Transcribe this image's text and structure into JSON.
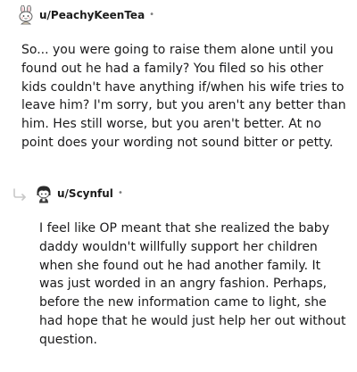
{
  "comments": [
    {
      "username": "u/PeachyKeenTea",
      "separator": "•",
      "avatar_icon": "snoo-bunny-avatar-icon",
      "body_lines": [
        "So... you were going to raise them alone until you",
        "found out he had a family? You filed so his other",
        "kids couldn't have anything if/when his wife tries to",
        "leave him? I'm sorry, but you aren't any better than",
        "him. Hes still worse, but you aren't better. At no",
        "point does your wording not sound bitter or petty."
      ]
    },
    {
      "username": "u/Scynful",
      "separator": "•",
      "avatar_icon": "snoo-dark-hair-avatar-icon",
      "reply_icon": "reply-arrow-icon",
      "body_lines": [
        "I feel like OP meant that she realized the baby",
        "daddy wouldn't willfully support her children",
        "when she found out he had another family. It",
        "was just worded in an angry fashion. Perhaps,",
        "before the new information came to light, she",
        "had hope that he would just help her out without",
        "question."
      ]
    }
  ],
  "colors": {
    "text": "#1a1a1b",
    "meta": "#7c7c7c",
    "reply_arrow": "#c8c8c8"
  }
}
